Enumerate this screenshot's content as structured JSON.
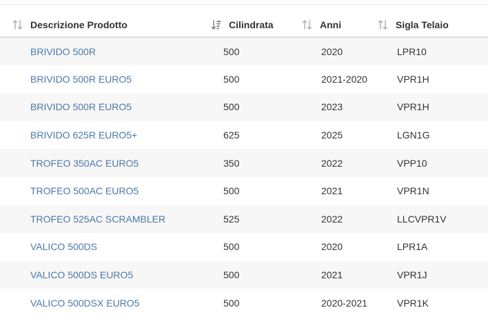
{
  "table": {
    "columns": [
      {
        "label": "Descrizione Prodotto",
        "sort_icon": "sort-icon",
        "sort_state": "unsorted"
      },
      {
        "label": "Cilindrata",
        "sort_icon": "sort-amount-down-icon",
        "sort_state": "sorted"
      },
      {
        "label": "Anni",
        "sort_icon": "sort-icon",
        "sort_state": "unsorted"
      },
      {
        "label": "Sigla Telaio",
        "sort_icon": "sort-icon",
        "sort_state": "unsorted"
      }
    ],
    "rows": [
      {
        "descrizione": "BRIVIDO 500R",
        "cilindrata": "500",
        "anni": "2020",
        "sigla": "LPR10"
      },
      {
        "descrizione": "BRIVIDO 500R EURO5",
        "cilindrata": "500",
        "anni": "2021-2020",
        "sigla": "VPR1H"
      },
      {
        "descrizione": "BRIVIDO 500R EURO5",
        "cilindrata": "500",
        "anni": "2023",
        "sigla": "VPR1H"
      },
      {
        "descrizione": "BRIVIDO 625R EURO5+",
        "cilindrata": "625",
        "anni": "2025",
        "sigla": "LGN1G"
      },
      {
        "descrizione": "TROFEO 350AC EURO5",
        "cilindrata": "350",
        "anni": "2022",
        "sigla": "VPP10"
      },
      {
        "descrizione": "TROFEO 500AC EURO5",
        "cilindrata": "500",
        "anni": "2021",
        "sigla": "VPR1N"
      },
      {
        "descrizione": "TROFEO 525AC SCRAMBLER",
        "cilindrata": "525",
        "anni": "2022",
        "sigla": "LLCVPR1V"
      },
      {
        "descrizione": "VALICO 500DS",
        "cilindrata": "500",
        "anni": "2020",
        "sigla": "LPR1A"
      },
      {
        "descrizione": "VALICO 500DS EURO5",
        "cilindrata": "500",
        "anni": "2021",
        "sigla": "VPR1J"
      },
      {
        "descrizione": "VALICO 500DSX EURO5",
        "cilindrata": "500",
        "anni": "2020-2021",
        "sigla": "VPR1K"
      }
    ]
  },
  "colors": {
    "link": "#4a78a8",
    "text": "#333333",
    "stripe": "#f7f7f7",
    "icon": "#b5b5b5",
    "icon_active": "#8a8a8a"
  }
}
